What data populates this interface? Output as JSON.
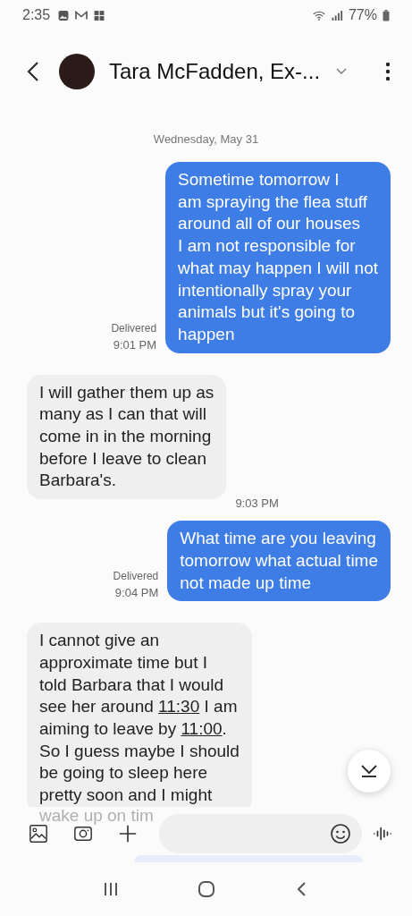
{
  "status_bar": {
    "time": "2:35",
    "battery": "77%"
  },
  "header": {
    "title": "Tara McFadden, Ex-..."
  },
  "date_divider": "Wednesday, May 31",
  "messages": [
    {
      "kind": "sent",
      "status": "Delivered",
      "time": "9:01 PM",
      "lines": [
        "Sometime tomorrow I",
        "am spraying the flea stuff",
        "around all of our houses",
        "I am not responsible for",
        "what may happen I will not",
        "intentionally spray your",
        "animals but it's going to",
        "happen"
      ]
    },
    {
      "kind": "received",
      "time": "9:03 PM",
      "lines": [
        "I will gather them up as",
        "many as I can that will",
        "come in in the morning",
        "before I leave to clean",
        "Barbara's."
      ]
    },
    {
      "kind": "sent",
      "status": "Delivered",
      "time": "9:04 PM",
      "lines": [
        "What time are you leaving",
        "tomorrow what actual time",
        "not made up time"
      ]
    },
    {
      "kind": "received",
      "lines": [
        "I cannot give an",
        "approximate time but I",
        "told Barbara that I would",
        [
          {
            "kind": "text",
            "text": "see her around "
          },
          {
            "kind": "link",
            "text": "11:30"
          },
          {
            "kind": "text",
            "text": " I am"
          }
        ],
        [
          {
            "kind": "text",
            "text": "aiming to leave by "
          },
          {
            "kind": "link",
            "text": "11:00"
          },
          {
            "kind": "text",
            "text": "."
          }
        ],
        "So I guess maybe I should",
        "be going to sleep here",
        "pretty soon and I might"
      ]
    }
  ],
  "faded_text": "wake up on tim"
}
